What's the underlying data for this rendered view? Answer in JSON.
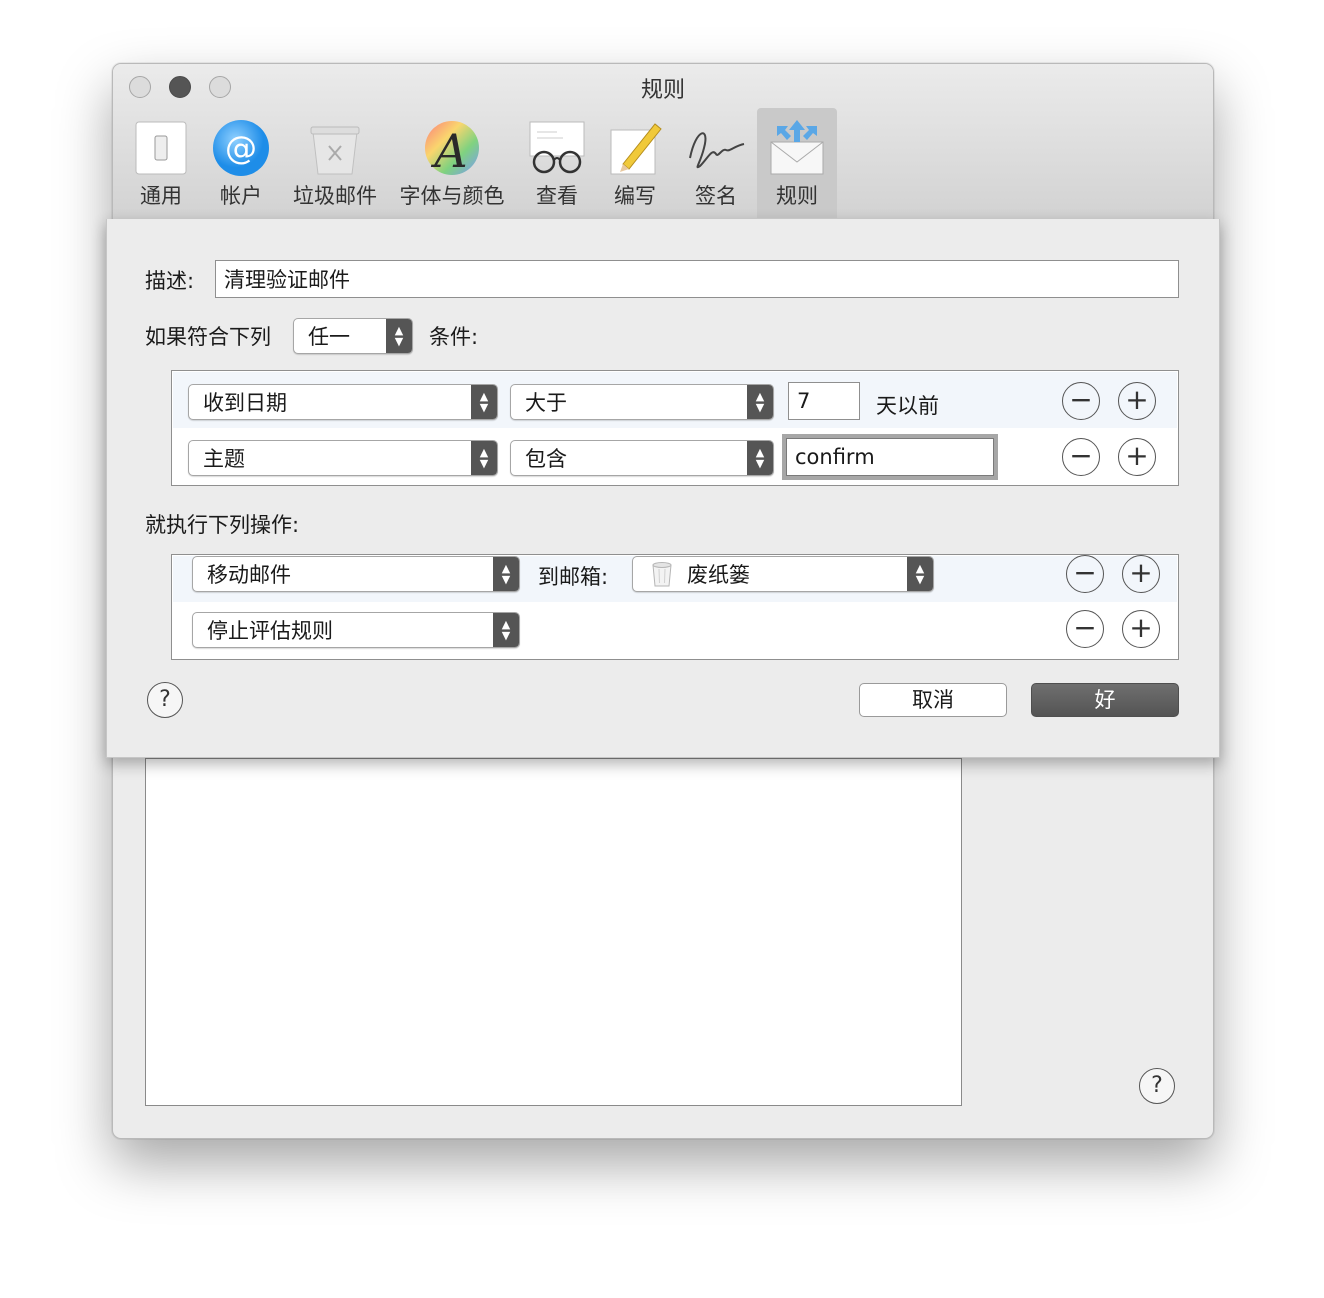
{
  "window": {
    "title": "规则"
  },
  "toolbar": {
    "tabs": [
      {
        "label": "通用",
        "icon": "switch-icon"
      },
      {
        "label": "帐户",
        "icon": "at-sign-icon"
      },
      {
        "label": "垃圾邮件",
        "icon": "junk-trash-icon"
      },
      {
        "label": "字体与颜色",
        "icon": "font-color-icon"
      },
      {
        "label": "查看",
        "icon": "glasses-icon"
      },
      {
        "label": "编写",
        "icon": "pencil-paper-icon"
      },
      {
        "label": "签名",
        "icon": "signature-icon"
      },
      {
        "label": "规则",
        "icon": "rules-envelope-icon",
        "selected": true
      }
    ]
  },
  "sheet": {
    "description_label": "描述:",
    "description_value": "清理验证邮件",
    "match_prefix": "如果符合下列",
    "match_value": "任一",
    "match_suffix": "条件:",
    "conditions": [
      {
        "field": "收到日期",
        "operator": "大于",
        "value": "7",
        "unit": "天以前"
      },
      {
        "field": "主题",
        "operator": "包含",
        "value": "confirm"
      }
    ],
    "actions_label": "就执行下列操作:",
    "actions": [
      {
        "action": "移动邮件",
        "target_label": "到邮箱:",
        "target": "废纸篓"
      },
      {
        "action": "停止评估规则"
      }
    ],
    "cancel_label": "取消",
    "ok_label": "好",
    "help_label": "?"
  },
  "background": {
    "help_label": "?"
  },
  "controls": {
    "minus": "−",
    "plus": "+"
  }
}
